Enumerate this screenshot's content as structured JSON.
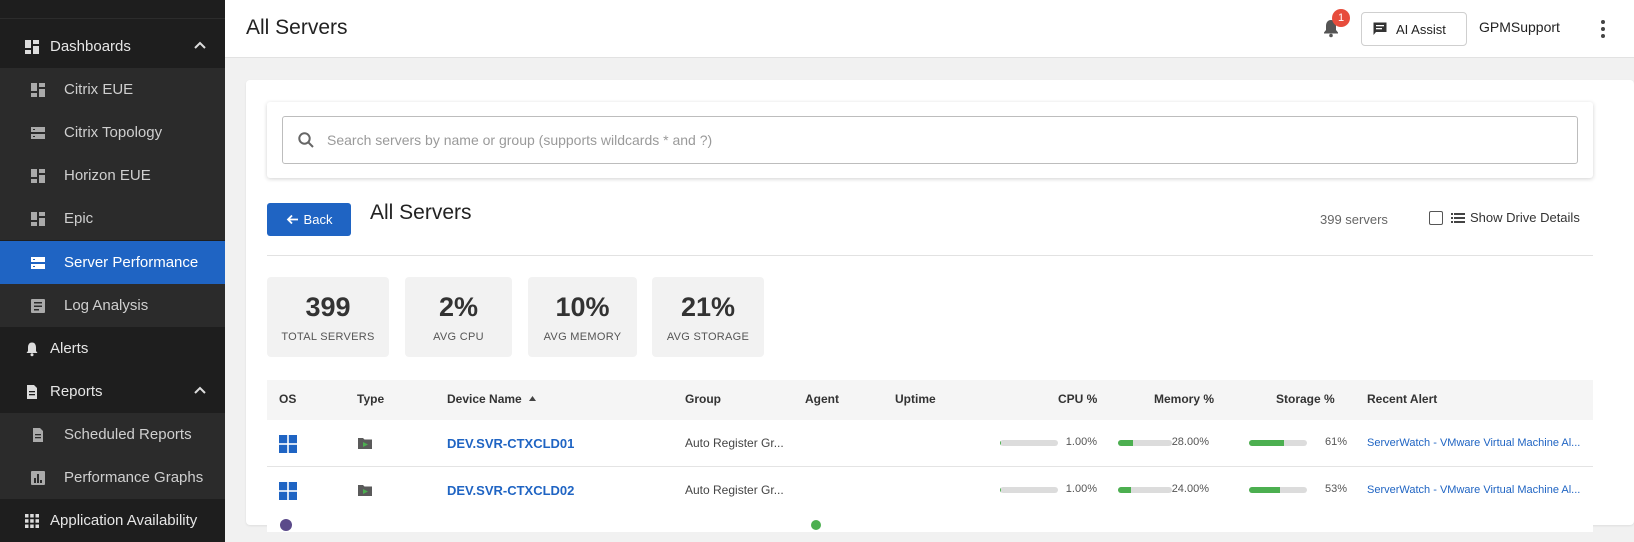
{
  "header": {
    "title": "All Servers",
    "notification_count": "1",
    "ai_assist_label": "AI Assist",
    "user_name": "GPMSupport"
  },
  "sidebar": {
    "items": [
      {
        "label": "Dashboards",
        "icon": "dashboard-icon",
        "level": "parent",
        "expanded": true
      },
      {
        "label": "Citrix EUE",
        "icon": "dashboard-icon",
        "level": "sub"
      },
      {
        "label": "Citrix Topology",
        "icon": "dns-icon",
        "level": "sub"
      },
      {
        "label": "Horizon EUE",
        "icon": "dashboard-icon",
        "level": "sub"
      },
      {
        "label": "Epic",
        "icon": "dashboard-icon",
        "level": "sub"
      },
      {
        "label": "Server Performance",
        "icon": "dns-icon",
        "level": "sub",
        "active": true
      },
      {
        "label": "Log Analysis",
        "icon": "article-icon",
        "level": "sub"
      },
      {
        "label": "Alerts",
        "icon": "bell-icon",
        "level": "parent"
      },
      {
        "label": "Reports",
        "icon": "description-icon",
        "level": "parent",
        "expanded": true
      },
      {
        "label": "Scheduled Reports",
        "icon": "description-icon",
        "level": "sub"
      },
      {
        "label": "Performance Graphs",
        "icon": "bar-chart-icon",
        "level": "sub"
      },
      {
        "label": "Application Availability",
        "icon": "apps-icon",
        "level": "parent"
      }
    ]
  },
  "search": {
    "placeholder": "Search servers by name or group (supports wildcards * and ?)",
    "value": ""
  },
  "toolbar": {
    "back_label": "Back",
    "section_title": "All Servers",
    "server_count": "399 servers",
    "show_drive_details_label": "Show Drive Details",
    "show_drive_details_checked": false
  },
  "stats": [
    {
      "value": "399",
      "label": "TOTAL SERVERS"
    },
    {
      "value": "2%",
      "label": "AVG CPU"
    },
    {
      "value": "10%",
      "label": "AVG MEMORY"
    },
    {
      "value": "21%",
      "label": "AVG STORAGE"
    }
  ],
  "table": {
    "columns": [
      "OS",
      "Type",
      "Device Name",
      "Group",
      "Agent",
      "Uptime",
      "CPU %",
      "Memory %",
      "Storage %",
      "Recent Alert"
    ],
    "sort_column": "Device Name",
    "sort_direction": "asc",
    "rows": [
      {
        "os": "windows-icon",
        "type": "server-type-icon",
        "device_name": "DEV.SVR-CTXCLD01",
        "group": "Auto Register Gr...",
        "agent": "",
        "uptime": "",
        "cpu": 1.0,
        "cpu_label": "1.00%",
        "memory": 28.0,
        "memory_label": "28.00%",
        "storage": 61,
        "storage_label": "61%",
        "recent_alert": "ServerWatch - VMware Virtual Machine Al..."
      },
      {
        "os": "windows-icon",
        "type": "server-type-icon",
        "device_name": "DEV.SVR-CTXCLD02",
        "group": "Auto Register Gr...",
        "agent": "",
        "uptime": "",
        "cpu": 1.0,
        "cpu_label": "1.00%",
        "memory": 24.0,
        "memory_label": "24.00%",
        "storage": 53,
        "storage_label": "53%",
        "recent_alert": "ServerWatch - VMware Virtual Machine Al..."
      }
    ]
  },
  "colors": {
    "accent": "#1f64c3",
    "sidebar_bg": "#1e1e1e",
    "bar_fill": "#4caf50",
    "badge": "#e74c3c"
  }
}
